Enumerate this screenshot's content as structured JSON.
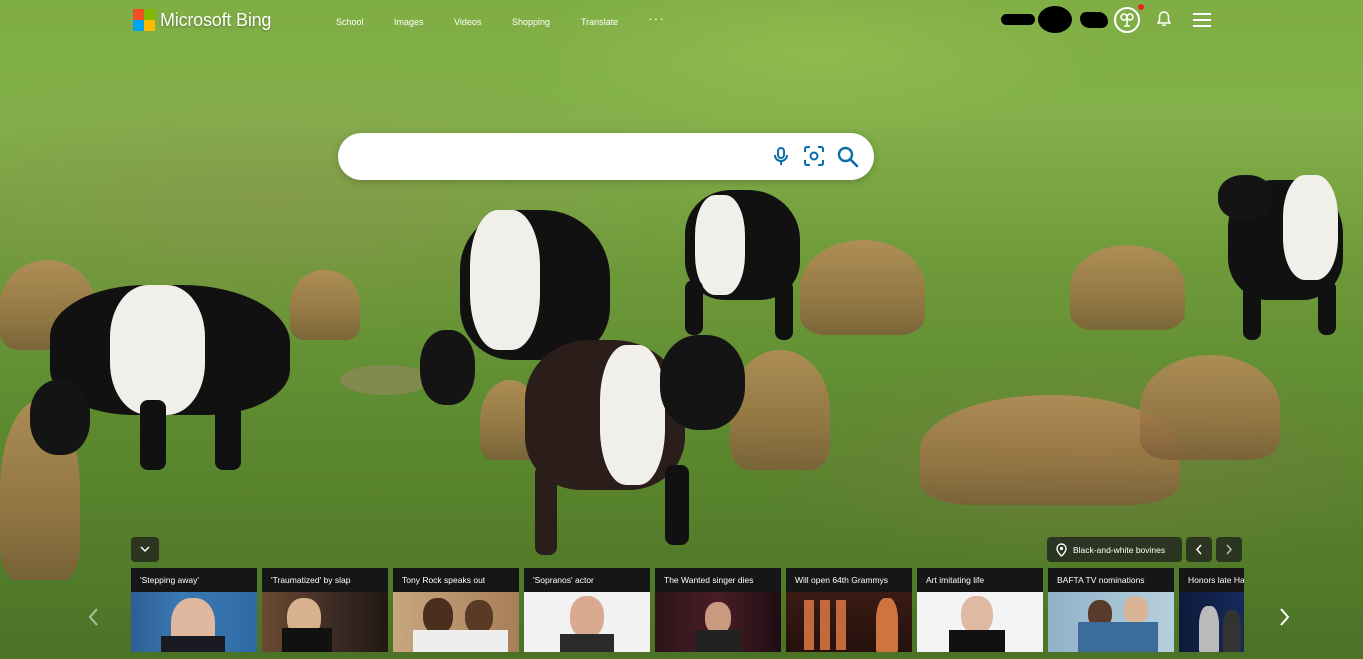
{
  "brand": {
    "name": "Microsoft Bing",
    "logo_colors": [
      "#f25022",
      "#7fba00",
      "#00a4ef",
      "#ffb900"
    ]
  },
  "nav": {
    "items": [
      {
        "label": "School"
      },
      {
        "label": "Images"
      },
      {
        "label": "Videos"
      },
      {
        "label": "Shopping"
      },
      {
        "label": "Translate"
      }
    ],
    "more_label": "···"
  },
  "header_icons": {
    "rewards": "rewards-trophy-icon",
    "notifications": "bell-icon",
    "menu": "hamburger-menu-icon"
  },
  "search": {
    "value": "",
    "placeholder": "",
    "mic_icon": "microphone-icon",
    "visual_icon": "visual-search-icon",
    "search_icon": "search-icon",
    "accent": "#0a6ea8"
  },
  "image_info": {
    "location_label": "Black-and-white bovines"
  },
  "news": {
    "cards": [
      {
        "title": "'Stepping away'"
      },
      {
        "title": "'Traumatized' by slap"
      },
      {
        "title": "Tony Rock speaks out"
      },
      {
        "title": "'Sopranos' actor"
      },
      {
        "title": "The Wanted singer dies"
      },
      {
        "title": "Will open 64th Grammys"
      },
      {
        "title": "Art imitating life"
      },
      {
        "title": "BAFTA TV nominations"
      },
      {
        "title": "Honors late Ha"
      }
    ]
  }
}
